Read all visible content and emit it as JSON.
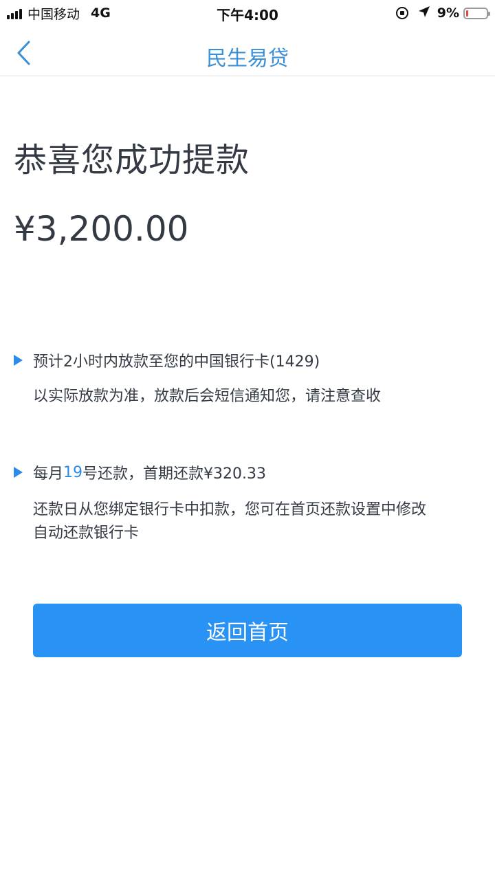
{
  "status_bar": {
    "carrier": "中国移动",
    "network": "4G",
    "time": "下午4:00",
    "battery_percent": "9%"
  },
  "nav": {
    "title": "民生易贷",
    "back_icon": "chevron-left-icon"
  },
  "main": {
    "headline": "恭喜您成功提款",
    "amount": "¥3,200.00",
    "info": [
      {
        "line": "预计2小时内放款至您的中国银行卡(1429)",
        "sub": "以实际放款为准，放款后会短信通知您，请注意查收"
      },
      {
        "line_prefix": "每月",
        "line_highlight": "19",
        "line_suffix": "号还款，首期还款¥320.33",
        "sub_lines": [
          "还款日从您绑定银行卡中扣款，您可在首页还款设置中修改",
          "自动还款银行卡"
        ]
      }
    ],
    "return_home_label": "返回首页"
  },
  "colors": {
    "accent": "#2892f5",
    "nav_title": "#3a8fd6",
    "text": "#333a44"
  }
}
